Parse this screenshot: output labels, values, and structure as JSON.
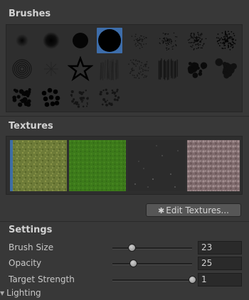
{
  "brushes": {
    "title": "Brushes",
    "selected_index": 3,
    "items": [
      {
        "icon": "soft-round-brush-small"
      },
      {
        "icon": "soft-round-brush-medium"
      },
      {
        "icon": "hard-round-brush-medium"
      },
      {
        "icon": "hard-round-brush-large"
      },
      {
        "icon": "splatter-brush"
      },
      {
        "icon": "speckle-brush"
      },
      {
        "icon": "noise-brush"
      },
      {
        "icon": "dense-noise-brush"
      },
      {
        "icon": "spiral-brush"
      },
      {
        "icon": "star-burst-brush"
      },
      {
        "icon": "star-outline-brush"
      },
      {
        "icon": "grass-strands-brush"
      },
      {
        "icon": "cross-hatch-brush"
      },
      {
        "icon": "vertical-strokes-brush"
      },
      {
        "icon": "blob-cluster-brush"
      },
      {
        "icon": "cloud-brush"
      },
      {
        "icon": "rough-blob-brush"
      },
      {
        "icon": "dots-cluster-brush"
      },
      {
        "icon": "scattered-dots-brush"
      },
      {
        "icon": "scatter-fine-brush"
      }
    ]
  },
  "textures": {
    "title": "Textures",
    "selected_index": 0,
    "items": [
      {
        "name": "grass-dirt-texture",
        "color": "#6b7a35"
      },
      {
        "name": "green-grass-texture",
        "color": "#3f7a1c"
      },
      {
        "name": "dark-gravel-texture",
        "color": "#2b2b2b"
      },
      {
        "name": "pebble-texture",
        "color": "#8a7678"
      }
    ],
    "edit_button": "Edit Textures..."
  },
  "settings": {
    "title": "Settings",
    "brush_size": {
      "label": "Brush Size",
      "value": "23",
      "fraction": 0.24
    },
    "opacity": {
      "label": "Opacity",
      "value": "25",
      "fraction": 0.26
    },
    "target_strength": {
      "label": "Target Strength",
      "value": "1",
      "fraction": 1.0
    }
  },
  "lighting": {
    "label": "Lighting"
  },
  "colors": {
    "background": "#383838",
    "selection": "#3d6daa"
  }
}
